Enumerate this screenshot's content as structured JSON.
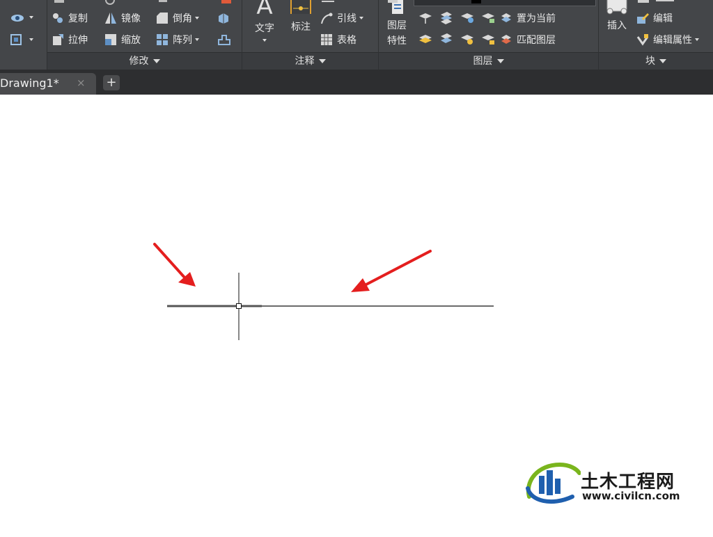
{
  "ribbon": {
    "modify_panel": {
      "items": [
        "复制",
        "镜像",
        "倒角",
        "拉伸",
        "缩放",
        "阵列"
      ],
      "title": "修改"
    },
    "annotation_panel": {
      "text_label": "文字",
      "dimension_label": "标注",
      "leader_label": "引线",
      "table_label": "表格",
      "title": "注释"
    },
    "layers_panel": {
      "properties_label_line1": "图层",
      "properties_label_line2": "特性",
      "set_current_label": "置为当前",
      "match_layer_label": "匹配图层",
      "title": "图层"
    },
    "block_panel": {
      "insert_label": "插入",
      "edit_label": "编辑",
      "edit_attributes_label": "编辑属性",
      "title": "块"
    }
  },
  "tabs": {
    "active_tab": "Drawing1*",
    "close_symbol": "×",
    "add_symbol": "+"
  },
  "watermark": {
    "title": "土木工程网",
    "url": "www.civilcn.com"
  },
  "colors": {
    "ribbon_bg": "#444649",
    "tabbar_bg": "#2d2e30",
    "arrow": "#e41e1e",
    "logo_green": "#7ab51d",
    "logo_blue": "#1f5fae"
  }
}
